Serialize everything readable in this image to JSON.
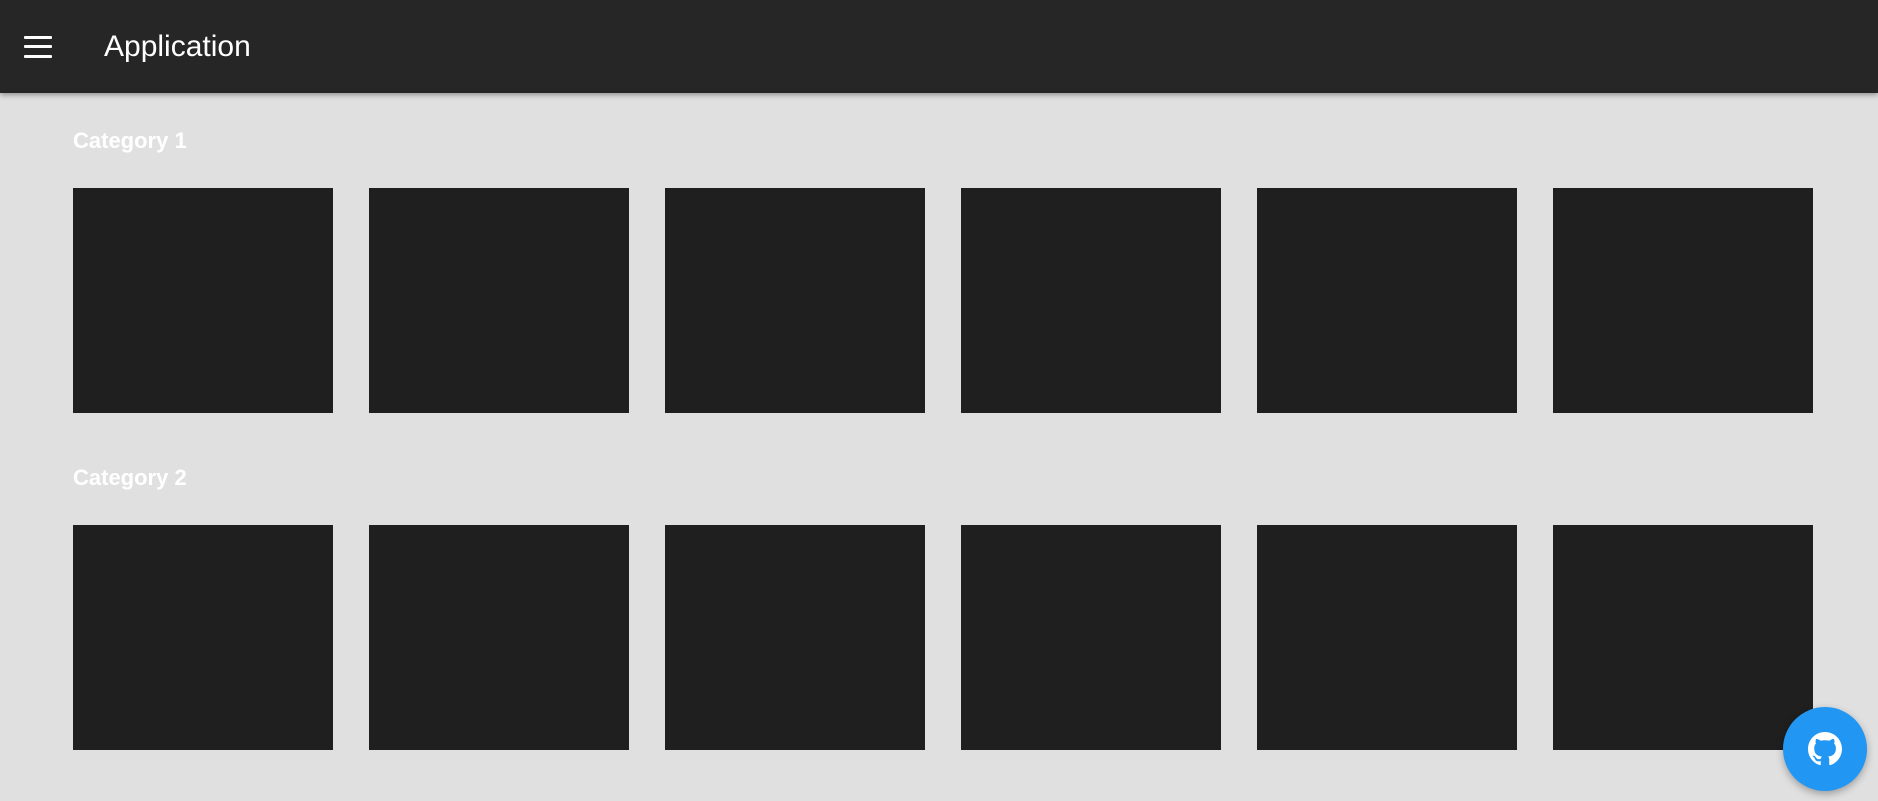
{
  "app_bar": {
    "title": "Application",
    "menu_icon": "menu-icon",
    "background": "#262626"
  },
  "categories": [
    {
      "title": "Category 1",
      "tile_count": 6
    },
    {
      "title": "Category 2",
      "tile_count": 6
    }
  ],
  "fab": {
    "icon": "github-icon",
    "color": "#2196f3"
  },
  "colors": {
    "page_background": "#e0e0e0",
    "tile": "#1f1f1f"
  }
}
